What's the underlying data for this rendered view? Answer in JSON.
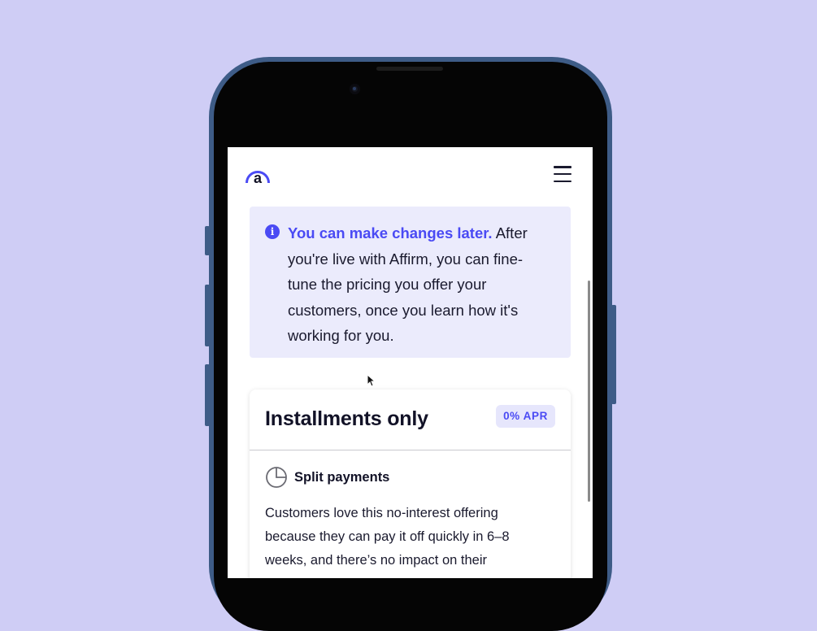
{
  "header": {
    "logo_icon": "affirm-logo-icon",
    "menu_icon": "hamburger-menu-icon"
  },
  "info_callout": {
    "icon": "info-icon",
    "icon_glyph": "i",
    "title": "You can make changes later.",
    "body": " After you're live with Affirm, you can fine-tune the pricing you offer your customers, once you learn how it's working for you."
  },
  "plan_card": {
    "title": "Installments only",
    "badge": "0% APR",
    "feature_icon": "pie-chart-icon",
    "feature_label": "Split payments",
    "description": "Customers love this no-interest offering because they can pay it off quickly in 6–8 weeks, and there’s no impact on their"
  },
  "colors": {
    "background": "#cfcdf5",
    "accent": "#4a4af4",
    "callout_bg": "#ebebfc",
    "phone_frame": "#3e5c87"
  }
}
